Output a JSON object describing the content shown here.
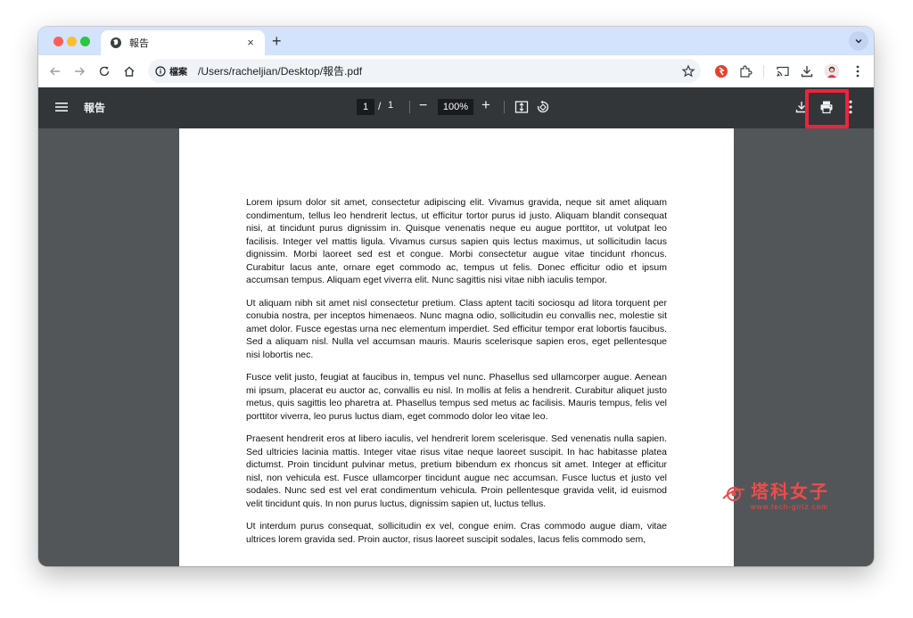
{
  "browser": {
    "tab": {
      "title": "報告",
      "close_glyph": "×"
    },
    "new_tab_glyph": "+",
    "omnibox": {
      "chip_label": "檔案",
      "url": "/Users/racheljian/Desktop/報告.pdf"
    }
  },
  "pdf_viewer": {
    "title": "報告",
    "page_current": "1",
    "page_separator": "/",
    "page_total": "1",
    "zoom": "100%",
    "highlight_color": "#ef233c"
  },
  "document": {
    "paragraphs": [
      "Lorem ipsum dolor sit amet, consectetur adipiscing elit. Vivamus gravida, neque sit amet aliquam condimentum, tellus leo hendrerit lectus, ut efficitur tortor purus id justo. Aliquam blandit consequat nisi, at tincidunt purus dignissim in. Quisque venenatis neque eu augue porttitor, ut volutpat leo facilisis. Integer vel mattis ligula. Vivamus cursus sapien quis lectus maximus, ut sollicitudin lacus dignissim. Morbi laoreet sed est et congue. Morbi consectetur augue vitae tincidunt rhoncus. Curabitur lacus ante, ornare eget commodo ac, tempus ut felis. Donec efficitur odio et ipsum accumsan tempus. Aliquam eget viverra elit. Nunc sagittis nisi vitae nibh iaculis tempor.",
      "Ut aliquam nibh sit amet nisl consectetur pretium. Class aptent taciti sociosqu ad litora torquent per conubia nostra, per inceptos himenaeos. Nunc magna odio, sollicitudin eu convallis nec, molestie sit amet dolor. Fusce egestas urna nec elementum imperdiet. Sed efficitur tempor erat lobortis faucibus. Sed a aliquam nisl. Nulla vel accumsan mauris. Mauris scelerisque sapien eros, eget pellentesque nisi lobortis nec.",
      "Fusce velit justo, feugiat at faucibus in, tempus vel nunc. Phasellus sed ullamcorper augue. Aenean mi ipsum, placerat eu auctor ac, convallis eu nisl. In mollis at felis a hendrerit. Curabitur aliquet justo metus, quis sagittis leo pharetra at. Phasellus tempus sed metus ac facilisis. Mauris tempus, felis vel porttitor viverra, leo purus luctus diam, eget commodo dolor leo vitae leo.",
      "Praesent hendrerit eros at libero iaculis, vel hendrerit lorem scelerisque. Sed venenatis nulla sapien. Sed ultricies lacinia mattis. Integer vitae risus vitae neque laoreet suscipit. In hac habitasse platea dictumst. Proin tincidunt pulvinar metus, pretium bibendum ex rhoncus sit amet. Integer at efficitur nisl, non vehicula est. Fusce ullamcorper tincidunt augue nec accumsan. Fusce luctus et justo vel sodales. Nunc sed est vel erat condimentum vehicula. Proin pellentesque gravida velit, id euismod velit tincidunt quis. In non purus luctus, dignissim sapien ut, luctus tellus.",
      "Ut interdum purus consequat, sollicitudin ex vel, congue enim. Cras commodo augue diam, vitae ultrices lorem gravida sed. Proin auctor, risus laoreet suscipit sodales, lacus felis commodo sem,"
    ]
  },
  "watermark": {
    "main": "塔科女子",
    "sub": "www.tech-girlz.com",
    "color": "#ef4b4b"
  },
  "icons": {
    "tab": "globe-icon",
    "toolbar": [
      "back-arrow-icon",
      "forward-arrow-icon",
      "reload-icon",
      "home-icon",
      "info-icon",
      "bookmark-star-icon",
      "extension-red-icon",
      "puzzle-extensions-icon",
      "cast-icon",
      "download-icon",
      "profile-avatar-icon",
      "more-vertical-icon"
    ],
    "pdf": [
      "menu-icon",
      "fit-page-icon",
      "rotate-icon",
      "download-icon",
      "print-icon",
      "more-vertical-icon"
    ]
  }
}
